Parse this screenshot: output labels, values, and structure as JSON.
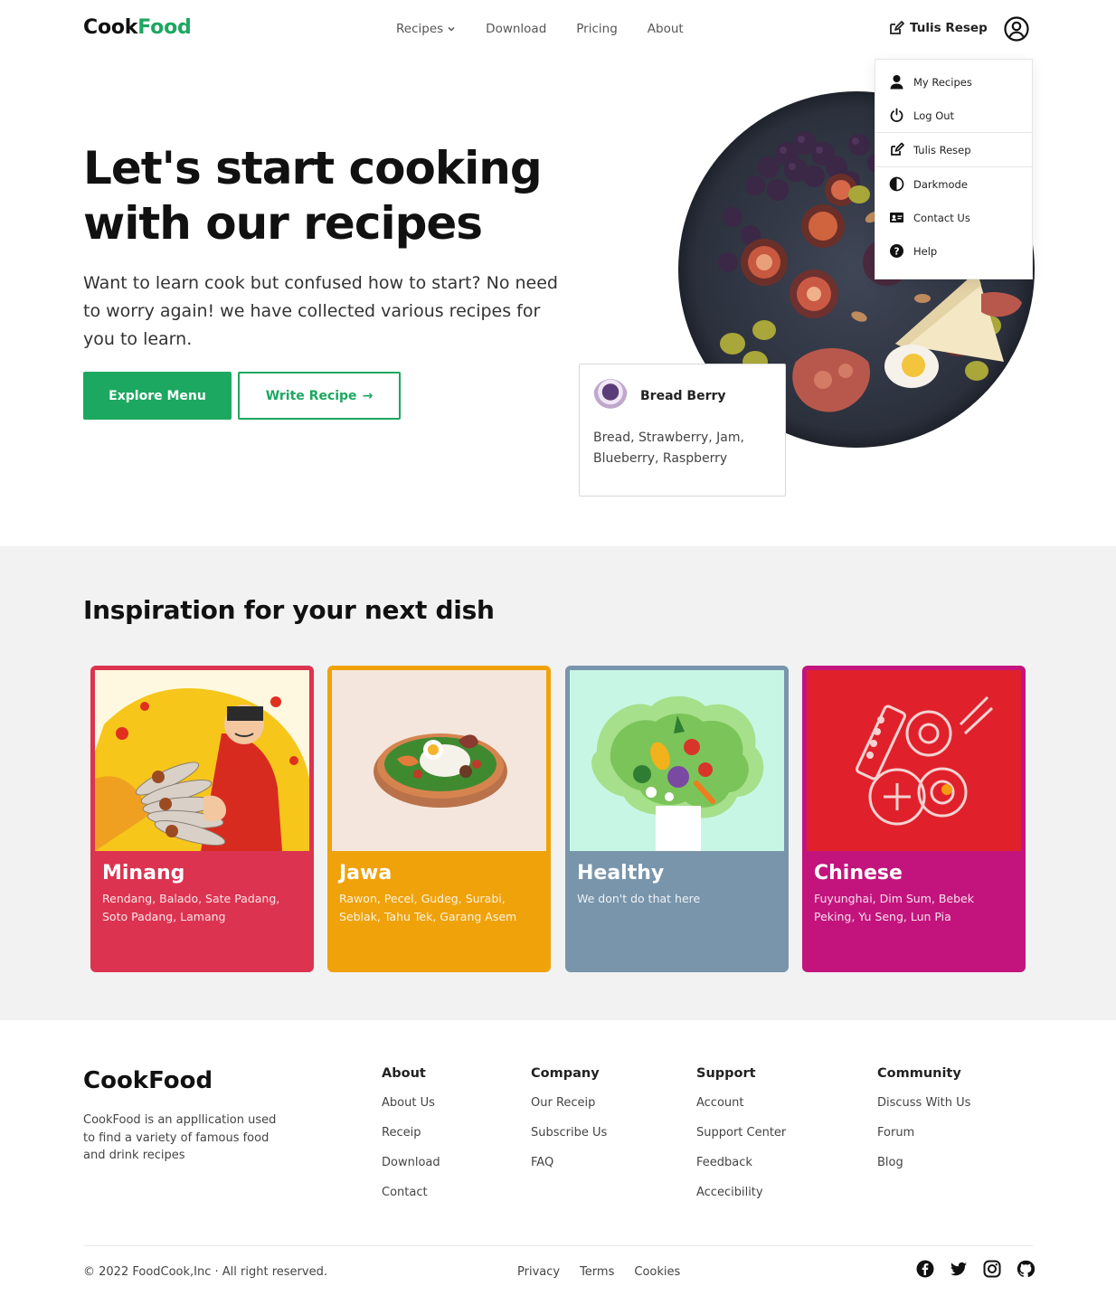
{
  "nav": {
    "logo_part1": "Cook",
    "logo_part2": "Food",
    "links": [
      "Recipes",
      "Download",
      "Pricing",
      "About"
    ],
    "write_label": "Tulis Resep"
  },
  "dropdown": {
    "items": [
      "My Recipes",
      "Log Out",
      "Tulis Resep",
      "Darkmode",
      "Contact Us",
      "Help"
    ]
  },
  "hero": {
    "title_line1": "Let's start cooking",
    "title_line2": "with our recipes",
    "subtitle": "Want to learn cook but confused how to start? No need to worry again! we have collected various recipes for you to learn.",
    "explore_label": "Explore Menu",
    "write_label": "Write Recipe"
  },
  "recipe_card": {
    "name": "Bread Berry",
    "ingredients": "Bread, Strawberry, Jam, Blueberry, Raspberry"
  },
  "inspiration": {
    "title": "Inspiration for your next dish",
    "categories": [
      {
        "name": "Minang",
        "desc": "Rendang, Balado, Sate Padang, Soto Padang, Lamang",
        "color": "#dc3350"
      },
      {
        "name": "Jawa",
        "desc": "Rawon, Pecel, Gudeg, Surabi, Seblak, Tahu Tek, Garang Asem",
        "color": "#efa20a"
      },
      {
        "name": "Healthy",
        "desc": "We don't do that here",
        "color": "#7895ab"
      },
      {
        "name": "Chinese",
        "desc": "Fuyunghai, Dim Sum, Bebek Peking, Yu Seng, Lun Pia",
        "color": "#c3147d"
      }
    ]
  },
  "footer": {
    "logo": "CookFood",
    "desc": "CookFood is an appllication used to find a variety of famous food and drink recipes",
    "columns": [
      {
        "title": "About",
        "links": [
          "About Us",
          "Receip",
          "Download",
          "Contact"
        ]
      },
      {
        "title": "Company",
        "links": [
          "Our Receip",
          "Subscribe Us",
          "FAQ"
        ]
      },
      {
        "title": "Support",
        "links": [
          "Account",
          "Support Center",
          "Feedback",
          "Accecibility"
        ]
      },
      {
        "title": "Community",
        "links": [
          "Discuss With Us",
          "Forum",
          "Blog"
        ]
      }
    ],
    "copyright": "© 2022 FoodCook,Inc · All right reserved.",
    "legal": [
      "Privacy",
      "Terms",
      "Cookies"
    ],
    "social": [
      "facebook-icon",
      "twitter-icon",
      "instagram-icon",
      "github-icon"
    ]
  },
  "colors": {
    "brand_green": "#1ca860",
    "section_bg": "#f2f2f2"
  }
}
